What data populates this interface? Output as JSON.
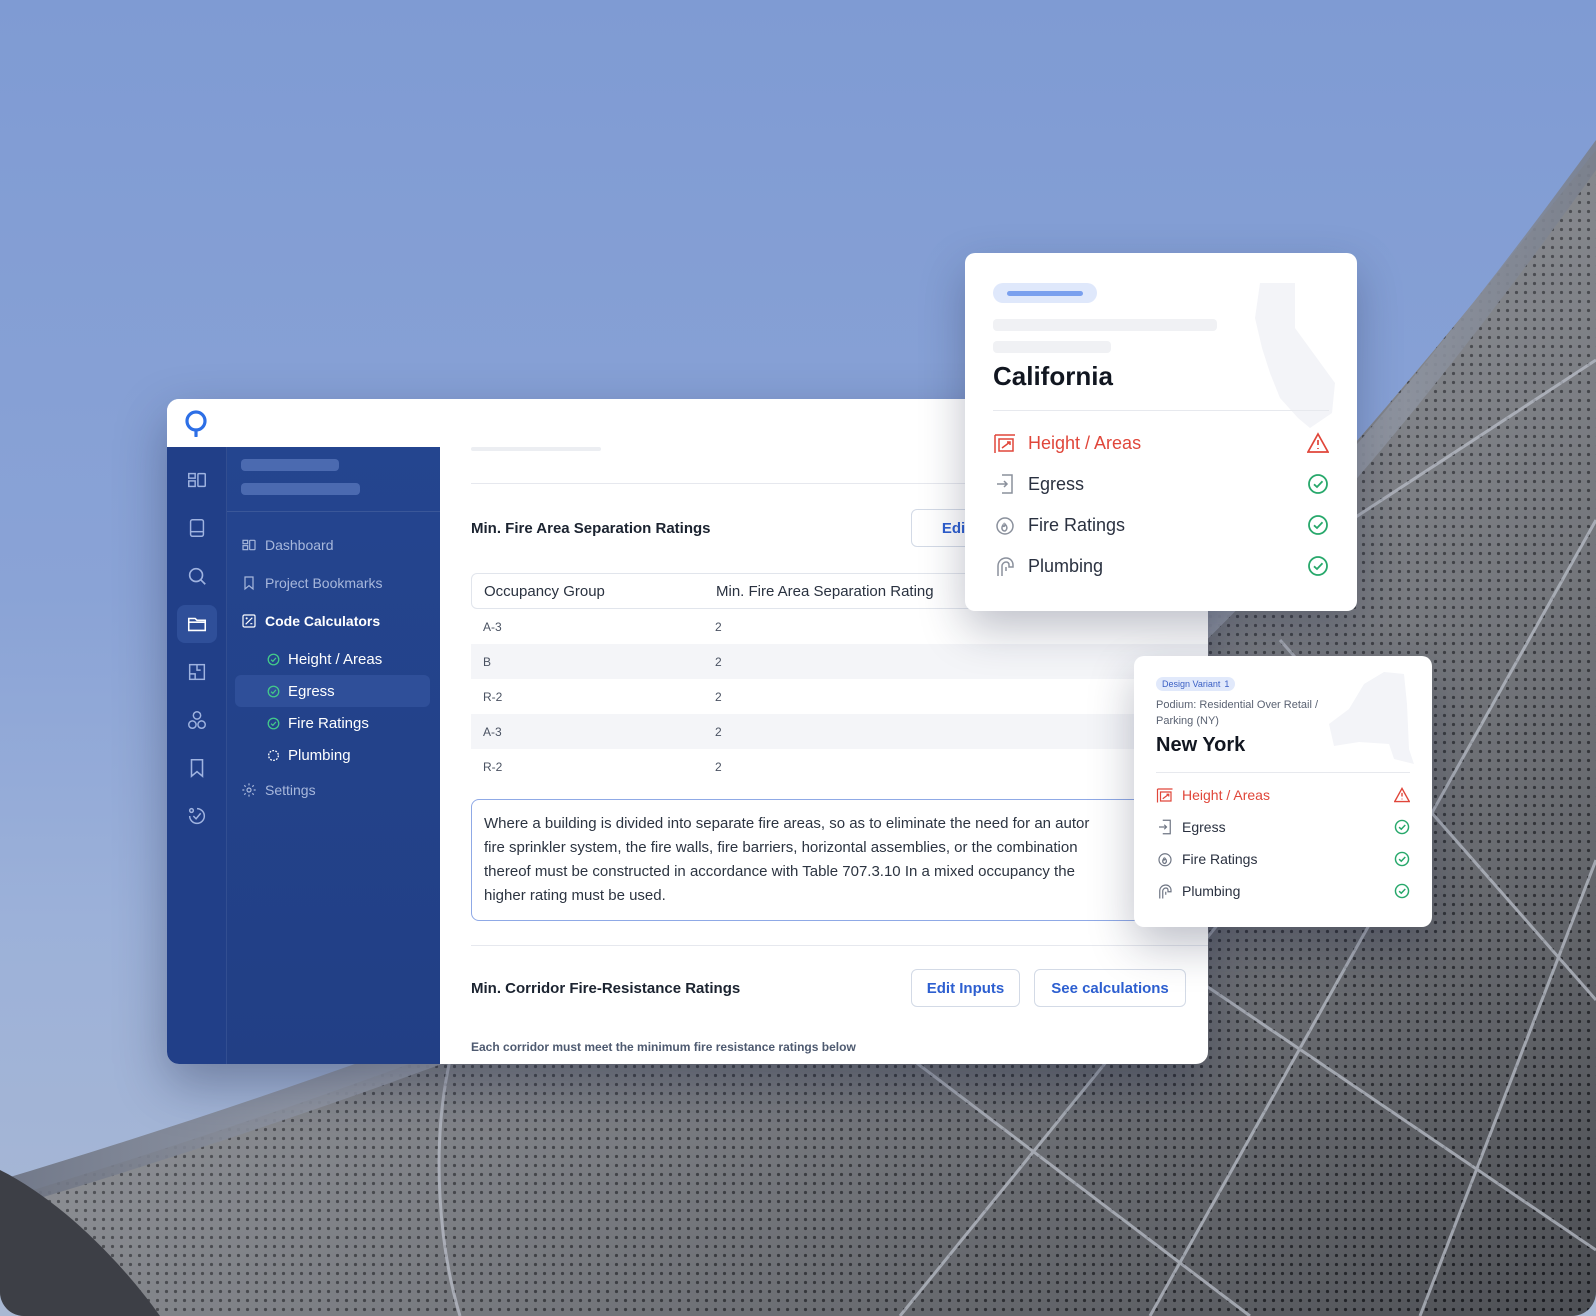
{
  "sidebar": {
    "items": [
      {
        "label": "Dashboard"
      },
      {
        "label": "Project Bookmarks"
      },
      {
        "label": "Code Calculators"
      },
      {
        "label": "Settings"
      }
    ],
    "sub_items": [
      {
        "label": "Height / Areas",
        "status": "done"
      },
      {
        "label": "Egress",
        "status": "done"
      },
      {
        "label": "Fire Ratings",
        "status": "done"
      },
      {
        "label": "Plumbing",
        "status": "pending"
      }
    ]
  },
  "main": {
    "section1": {
      "title": "Min. Fire Area Separation Ratings",
      "edit_label": "Edit"
    },
    "table": {
      "headers": [
        "Occupancy Group",
        "Min. Fire Area Separation Rating"
      ],
      "rows": [
        {
          "group": "A-3",
          "rating": "2"
        },
        {
          "group": "B",
          "rating": "2"
        },
        {
          "group": "R-2",
          "rating": "2"
        },
        {
          "group": "A-3",
          "rating": "2"
        },
        {
          "group": "R-2",
          "rating": "2"
        }
      ]
    },
    "note_lines": [
      "Where a building is divided into separate fire areas, so as to eliminate the need for an autor",
      "fire sprinkler system, the fire walls, fire barriers, horizontal assemblies, or the combination",
      "thereof must be constructed in accordance with Table 707.3.10    In a mixed occupancy the",
      "higher rating must be used."
    ],
    "section2": {
      "title": "Min. Corridor Fire-Resistance Ratings",
      "edit_inputs_label": "Edit Inputs",
      "see_calc_label": "See calculations",
      "note": "Each corridor must meet the minimum fire resistance ratings below"
    }
  },
  "california_card": {
    "state": "California",
    "rows": [
      {
        "label": "Height / Areas",
        "status": "warning"
      },
      {
        "label": "Egress",
        "status": "ok"
      },
      {
        "label": "Fire Ratings",
        "status": "ok"
      },
      {
        "label": "Plumbing",
        "status": "ok"
      }
    ]
  },
  "newyork_card": {
    "badge": "Design Variant",
    "badge_count": "1",
    "subtitle": "Podium: Residential Over Retail / Parking (NY)",
    "state": "New York",
    "rows": [
      {
        "label": "Height / Areas",
        "status": "warning"
      },
      {
        "label": "Egress",
        "status": "ok"
      },
      {
        "label": "Fire Ratings",
        "status": "ok"
      },
      {
        "label": "Plumbing",
        "status": "ok"
      }
    ]
  },
  "colors": {
    "brand": "#213f88",
    "accent": "#2d5fd0",
    "success": "#27a86b",
    "warning": "#e0463a"
  }
}
